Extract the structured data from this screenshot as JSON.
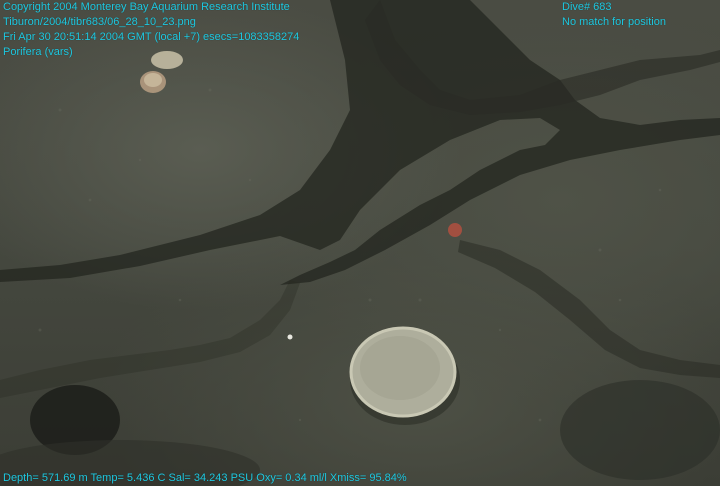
{
  "overlay": {
    "top_left": [
      "Copyright 2004 Monterey Bay Aquarium Research Institute",
      "Tiburon/2004/tibr683/06_28_10_23.png",
      "Fri Apr 30 20:51:14 2004 GMT (local +7)  esecs=1083358274",
      "Porifera (vars)"
    ],
    "top_right": [
      "Dive# 683",
      "No match for position"
    ],
    "bottom": "Depth= 571.69 m  Temp= 5.436 C  Sal= 34.243 PSU  Oxy= 0.34 ml/l  Xmiss= 95.84%"
  },
  "colors": {
    "overlay_text": "#1ec8e0",
    "rock": "#4a4c43",
    "crack": "#1f211c",
    "sponge": "#b7b5a2"
  }
}
